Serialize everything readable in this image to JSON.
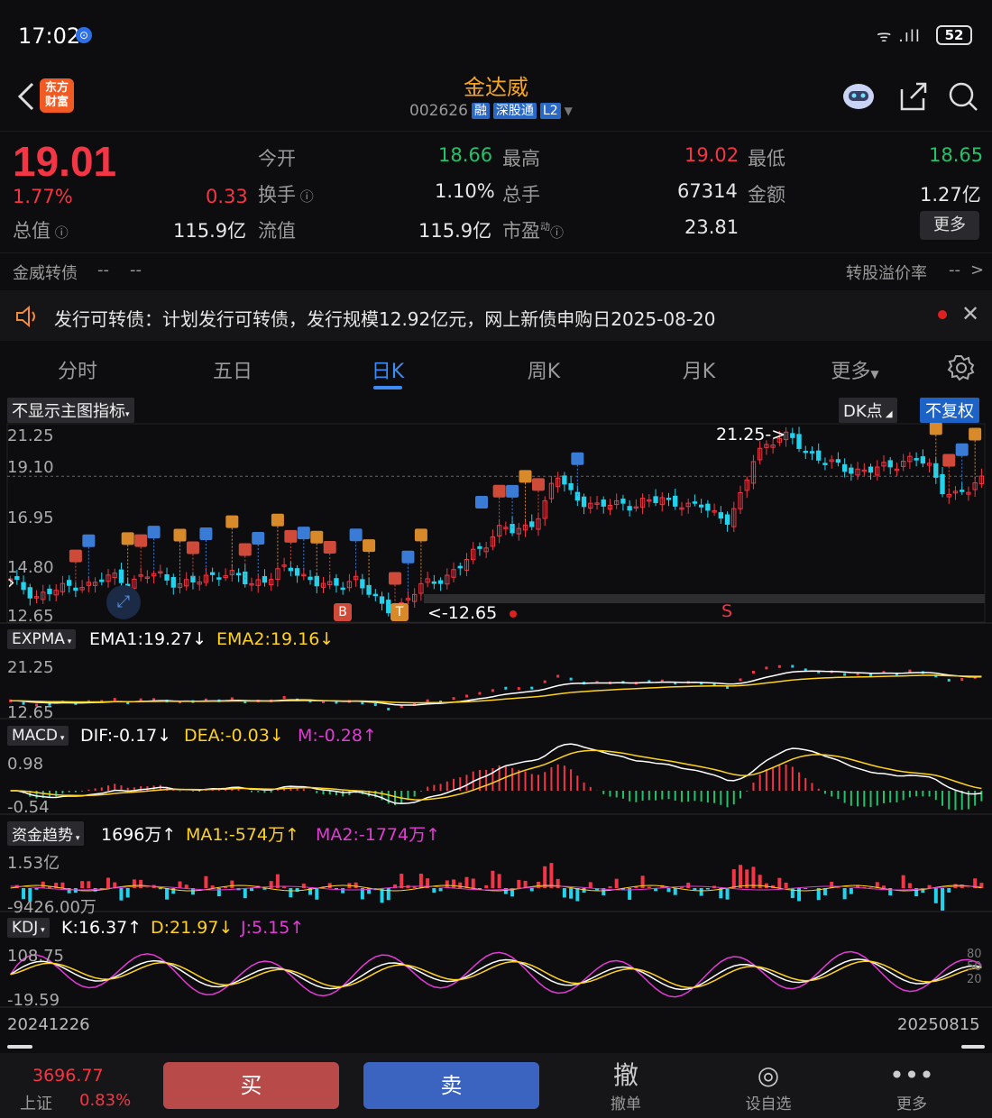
{
  "status": {
    "time": "17:02",
    "battery": "52",
    "signal": "ᯤ .ıll"
  },
  "header": {
    "logo_text": "东方财富",
    "name": "金达威",
    "code": "002626",
    "tags": [
      "融",
      "深股通",
      "L2"
    ]
  },
  "quote": {
    "price": "19.01",
    "pct": "1.77%",
    "change": "0.33",
    "open_label": "今开",
    "open": "18.66",
    "high_label": "最高",
    "high": "19.02",
    "low_label": "最低",
    "low": "18.65",
    "turnover_label": "换手",
    "turnover": "1.10%",
    "volume_label": "总手",
    "volume": "67314",
    "amount_label": "金额",
    "amount": "1.27亿",
    "mcap_label": "总值",
    "mcap": "115.9亿",
    "float_label": "流值",
    "float": "115.9亿",
    "pe_label": "市盈",
    "pe_sup": "动",
    "pe": "23.81",
    "more": "更多"
  },
  "bond": {
    "label": "金威转债",
    "v1": "--",
    "v2": "--",
    "premium_label": "转股溢价率",
    "premium": "--",
    "arrow": ">"
  },
  "notice": {
    "text": "发行可转债：计划发行可转债，发行规模12.92亿元，网上新债申购日2025-08-20"
  },
  "tabs": [
    "分时",
    "五日",
    "日K",
    "周K",
    "月K",
    "更多"
  ],
  "chart": {
    "main_indicator_btn": "不显示主图指标",
    "dk_btn": "DK点",
    "fq_btn": "不复权",
    "price_axis": [
      "21.25",
      "19.10",
      "16.95",
      "14.80",
      "12.65"
    ],
    "high_marker": "21.25->",
    "low_marker": "<-12.65",
    "signal_S": "S",
    "signal_B": "B",
    "signal_T": "T",
    "expma": {
      "name": "EXPMA",
      "ema1": "EMA1:19.27",
      "ema2": "EMA2:19.16",
      "top": "21.25",
      "bottom": "12.65"
    },
    "macd": {
      "name": "MACD",
      "dif": "DIF:-0.17",
      "dea": "DEA:-0.03",
      "m": "M:-0.28",
      "top": "0.98",
      "bottom": "-0.54"
    },
    "fund": {
      "name": "资金趋势",
      "v": "1696万",
      "ma1": "MA1:-574万",
      "ma2": "MA2:-1774万",
      "top": "1.53亿",
      "bottom": "-9426.00万"
    },
    "kdj": {
      "name": "KDJ",
      "k": "K:16.37",
      "d": "D:21.97",
      "j": "J:5.15",
      "top": "108.75",
      "bottom": "-19.59",
      "r80": "80",
      "r50": "50",
      "r20": "20"
    },
    "date_start": "20241226",
    "date_end": "20250815"
  },
  "chart_data": {
    "type": "candlestick",
    "x_range": [
      "20241226",
      "20250815"
    ],
    "ylim": [
      12.65,
      21.25
    ],
    "close_path": [
      14.2,
      13.9,
      13.5,
      13.7,
      13.9,
      14.1,
      14.0,
      14.3,
      14.5,
      14.1,
      14.4,
      14.6,
      14.3,
      14.0,
      14.2,
      14.5,
      14.6,
      14.4,
      14.1,
      14.3,
      14.6,
      14.8,
      14.5,
      14.2,
      13.9,
      14.1,
      14.4,
      13.6,
      13.0,
      12.9,
      13.5,
      14.0,
      14.3,
      14.5,
      15.0,
      15.6,
      16.2,
      16.8,
      16.4,
      16.9,
      17.5,
      19.2,
      18.4,
      18.0,
      17.6,
      17.8,
      17.9,
      17.7,
      17.9,
      18.1,
      17.9,
      17.6,
      17.8,
      17.4,
      17.0,
      18.2,
      20.3,
      20.6,
      20.9,
      20.8,
      20.2,
      19.8,
      19.6,
      19.5,
      19.3,
      19.4,
      19.6,
      19.8,
      19.9,
      19.6,
      18.6,
      18.2,
      18.4,
      19.01
    ],
    "expma": {
      "ema1": 19.27,
      "ema2": 19.16
    },
    "macd": {
      "dif": -0.17,
      "dea": -0.03,
      "m": -0.28,
      "range": [
        -0.54,
        0.98
      ]
    },
    "fund_trend": {
      "value": "1696万",
      "ma1": "-574万",
      "ma2": "-1774万",
      "range": [
        "-9426.00万",
        "1.53亿"
      ]
    },
    "kdj": {
      "k": 16.37,
      "d": 21.97,
      "j": 5.15,
      "range": [
        -19.59,
        108.75
      ]
    }
  },
  "bottom": {
    "index_value": "3696.77",
    "index_name": "上证",
    "index_pct": "0.83%",
    "buy": "买",
    "sell": "卖",
    "cancel_icon": "撤",
    "cancel": "撤单",
    "fav": "设自选",
    "more": "更多"
  }
}
